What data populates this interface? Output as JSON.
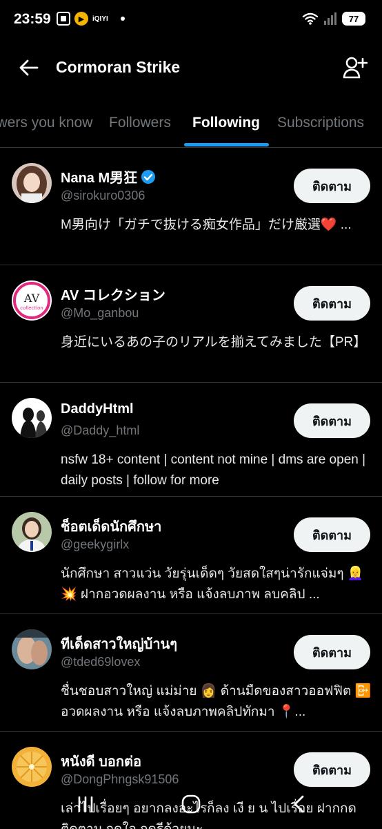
{
  "status_bar": {
    "time": "23:59",
    "app_label": "iQIYI",
    "battery": "77"
  },
  "header": {
    "title": "Cormoran Strike"
  },
  "tabs": [
    {
      "label": "Followers you know",
      "active": false
    },
    {
      "label": "Followers",
      "active": false
    },
    {
      "label": "Following",
      "active": true
    },
    {
      "label": "Subscriptions",
      "active": false
    }
  ],
  "accounts": [
    {
      "name": "Nana M男狂",
      "verified": true,
      "handle": "@sirokuro0306",
      "bio": "M男向け「ガチで抜ける痴女作品」だけ厳選❤️ ...",
      "button": "ติดตาม"
    },
    {
      "name": "AV コレクション",
      "verified": false,
      "handle": "@Mo_ganbou",
      "bio": "身近にいるあの子のリアルを揃えてみました【PR】",
      "button": "ติดตาม"
    },
    {
      "name": "DaddyHtml",
      "verified": false,
      "handle": "@Daddy_html",
      "bio": "nsfw 18+ content | content not mine | dms are open | daily posts | follow for more",
      "button": "ติดตาม"
    },
    {
      "name": "ช็อตเด็ดนักศึกษา",
      "verified": false,
      "handle": "@geekygirlx",
      "bio": "นักศึกษา สาวแว่น วัยรุ่นเด็ดๆ วัยสดใสๆน่ารักแจ่มๆ 👱‍♀️ 💥 ฝากอวดผลงาน หรือ แจ้งลบภาพ ลบคลิป ...",
      "button": "ติดตาม"
    },
    {
      "name": "ทีเด็ดสาวใหญ่บ้านๆ",
      "verified": false,
      "handle": "@tded69lovex",
      "bio": "ชื่นชอบสาวใหญ่ แม่ม่าย 👩 ด้านมืดของสาวออฟฟิต 📴 อวดผลงาน หรือ แจ้งลบภาพคลิปทักมา 📍...",
      "button": "ติดตาม"
    },
    {
      "name": "หนังดี บอกต่อ",
      "verified": false,
      "handle": "@DongPhngsk91506",
      "bio": "เล่าไปเรื่อยๆ อยากลงอะไรก็ลง เงี ย น ไปเรื่อย ฝากกดติดตาม กดใจ กดรีด้วยนะ",
      "button": "ติดตาม"
    }
  ],
  "colors": {
    "accent": "#1d9bf0",
    "background": "#000000",
    "divider": "#2f3336",
    "secondary_text": "#71767b",
    "button_bg": "#eff3f4"
  }
}
